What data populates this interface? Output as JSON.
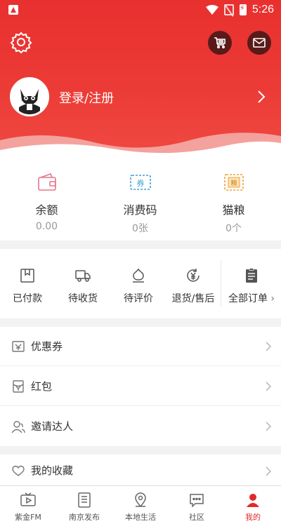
{
  "status_bar": {
    "time": "5:26"
  },
  "header": {
    "login_label": "登录/注册"
  },
  "wallet": [
    {
      "label": "余额",
      "value": "0.00"
    },
    {
      "label": "消费码",
      "value": "0张"
    },
    {
      "label": "猫粮",
      "value": "0个"
    }
  ],
  "wallet_icons": {
    "coupon_text": "券",
    "grain_text": "粮"
  },
  "orders": [
    {
      "label": "已付款"
    },
    {
      "label": "待收货"
    },
    {
      "label": "待评价"
    },
    {
      "label": "退货/售后"
    },
    {
      "label": "全部订单"
    }
  ],
  "menu": [
    {
      "label": "优惠券"
    },
    {
      "label": "红包"
    },
    {
      "label": "邀请达人"
    },
    {
      "label": "我的收藏"
    }
  ],
  "tabs": [
    {
      "label": "紫金FM"
    },
    {
      "label": "南京发布"
    },
    {
      "label": "本地生活"
    },
    {
      "label": "社区"
    },
    {
      "label": "我的"
    }
  ],
  "colors": {
    "brand_red": "#e8302f",
    "active_tab": "#e02a2a"
  }
}
